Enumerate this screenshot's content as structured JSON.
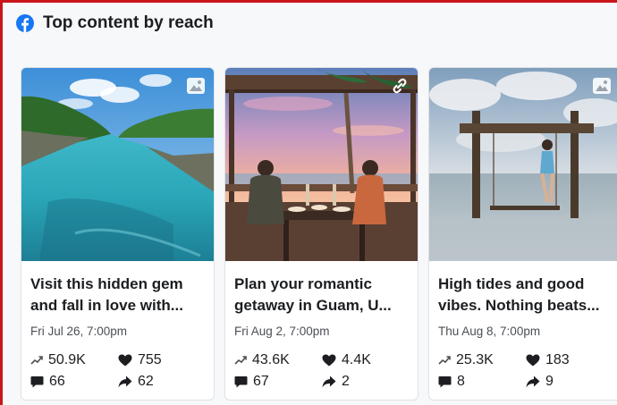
{
  "header": {
    "title": "Top content by reach",
    "logo_icon": "facebook-logo-icon"
  },
  "colors": {
    "brand": "#1877f2",
    "border_accent": "#c9151b"
  },
  "cards": [
    {
      "title": "Visit this hidden gem\nand fall in love with...",
      "date": "Fri Jul 26, 7:00pm",
      "reach": "50.9K",
      "reactions": "755",
      "comments": "66",
      "shares": "62",
      "type_icon": "photo-icon"
    },
    {
      "title": "Plan your romantic\ngetaway in Guam, U...",
      "date": "Fri Aug 2, 7:00pm",
      "reach": "43.6K",
      "reactions": "4.4K",
      "comments": "67",
      "shares": "2",
      "type_icon": "link-icon"
    },
    {
      "title": "High tides and good\nvibes. Nothing beats...",
      "date": "Thu Aug 8, 7:00pm",
      "reach": "25.3K",
      "reactions": "183",
      "comments": "8",
      "shares": "9",
      "type_icon": "photo-icon"
    }
  ]
}
